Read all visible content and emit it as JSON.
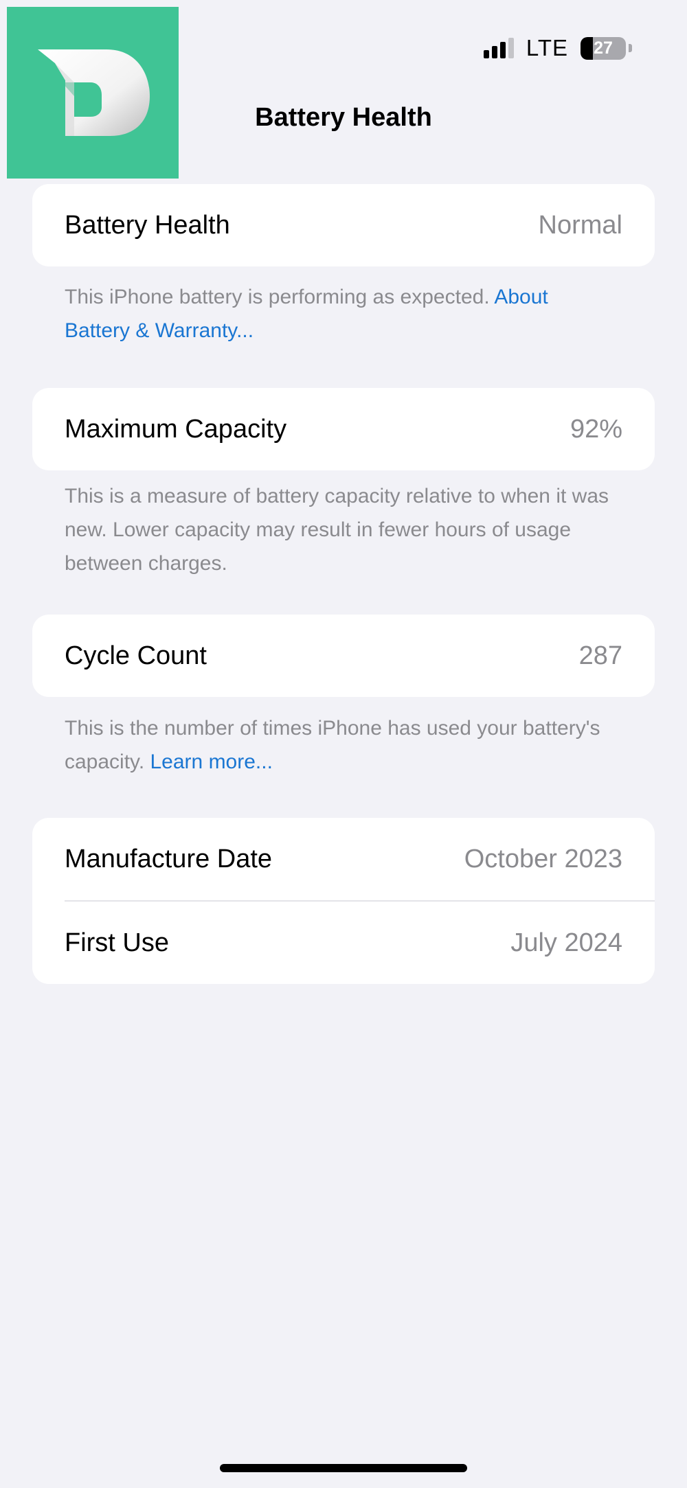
{
  "status_bar": {
    "network": "LTE",
    "battery_percent": 27,
    "battery_label": "27",
    "signal_bars_active": 3,
    "signal_bars_total": 4
  },
  "header": {
    "title": "Battery Health"
  },
  "battery_health": {
    "label": "Battery Health",
    "value": "Normal",
    "footnote_text": "This iPhone battery is performing as expected. ",
    "footnote_link": "About Battery & Warranty..."
  },
  "maximum_capacity": {
    "label": "Maximum Capacity",
    "value": "92%",
    "footnote_text": "This is a measure of battery capacity relative to when it was new. Lower capacity may result in fewer hours of usage between charges."
  },
  "cycle_count": {
    "label": "Cycle Count",
    "value": "287",
    "footnote_text": "This is the number of times iPhone has used your battery's capacity. ",
    "footnote_link": "Learn more..."
  },
  "dates": {
    "manufacture_label": "Manufacture Date",
    "manufacture_value": "October 2023",
    "first_use_label": "First Use",
    "first_use_value": "July 2024"
  },
  "colors": {
    "background": "#f2f2f7",
    "logo_green": "#40c495",
    "link_blue": "#1a76d2",
    "secondary_text": "#8a8a8e"
  }
}
